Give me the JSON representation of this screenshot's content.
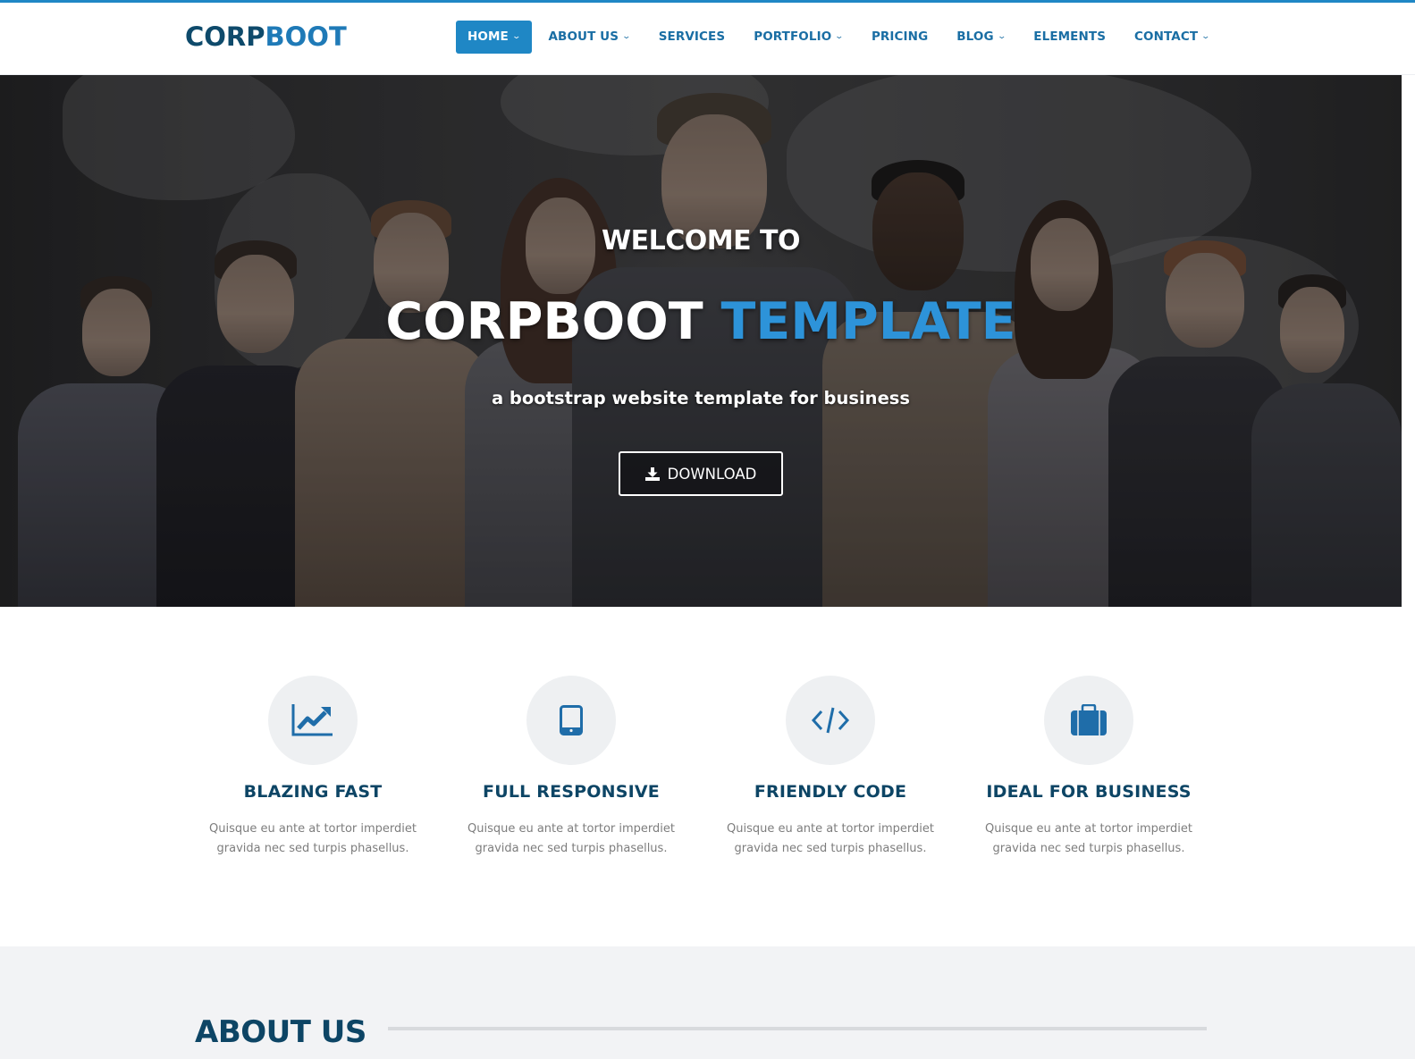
{
  "header": {
    "logo_part1": "CORP",
    "logo_part2": "BOOT",
    "nav": [
      {
        "label": "HOME",
        "has_dropdown": true,
        "active": true
      },
      {
        "label": "ABOUT US",
        "has_dropdown": true,
        "active": false
      },
      {
        "label": "SERVICES",
        "has_dropdown": false,
        "active": false
      },
      {
        "label": "PORTFOLIO",
        "has_dropdown": true,
        "active": false
      },
      {
        "label": "PRICING",
        "has_dropdown": false,
        "active": false
      },
      {
        "label": "BLOG",
        "has_dropdown": true,
        "active": false
      },
      {
        "label": "ELEMENTS",
        "has_dropdown": false,
        "active": false
      },
      {
        "label": "CONTACT",
        "has_dropdown": true,
        "active": false
      }
    ],
    "chevron": "⌄"
  },
  "hero": {
    "welcome": "WELCOME TO",
    "title_white": "CORPBOOT",
    "title_blue": "TEMPLATE",
    "subtitle": "a bootstrap website template for business",
    "download_label": "DOWNLOAD",
    "download_icon": "download-icon"
  },
  "features": [
    {
      "icon": "chart-line-icon",
      "title": "BLAZING FAST",
      "desc_line1": "Quisque eu ante at tortor imperdiet",
      "desc_line2": "gravida nec sed turpis phasellus."
    },
    {
      "icon": "tablet-icon",
      "title": "FULL RESPONSIVE",
      "desc_line1": "Quisque eu ante at tortor imperdiet",
      "desc_line2": "gravida nec sed turpis phasellus."
    },
    {
      "icon": "code-icon",
      "title": "FRIENDLY CODE",
      "desc_line1": "Quisque eu ante at tortor imperdiet",
      "desc_line2": "gravida nec sed turpis phasellus."
    },
    {
      "icon": "briefcase-icon",
      "title": "IDEAL FOR BUSINESS",
      "desc_line1": "Quisque eu ante at tortor imperdiet",
      "desc_line2": "gravida nec sed turpis phasellus."
    }
  ],
  "about": {
    "title": "ABOUT US"
  },
  "colors": {
    "accent": "#1f87c5",
    "brand_dark": "#0d4565",
    "title_blue": "#2d93d9",
    "text_gray": "#7d7d7d",
    "section_bg": "#f2f3f5",
    "icon_circle": "#eef0f2"
  }
}
